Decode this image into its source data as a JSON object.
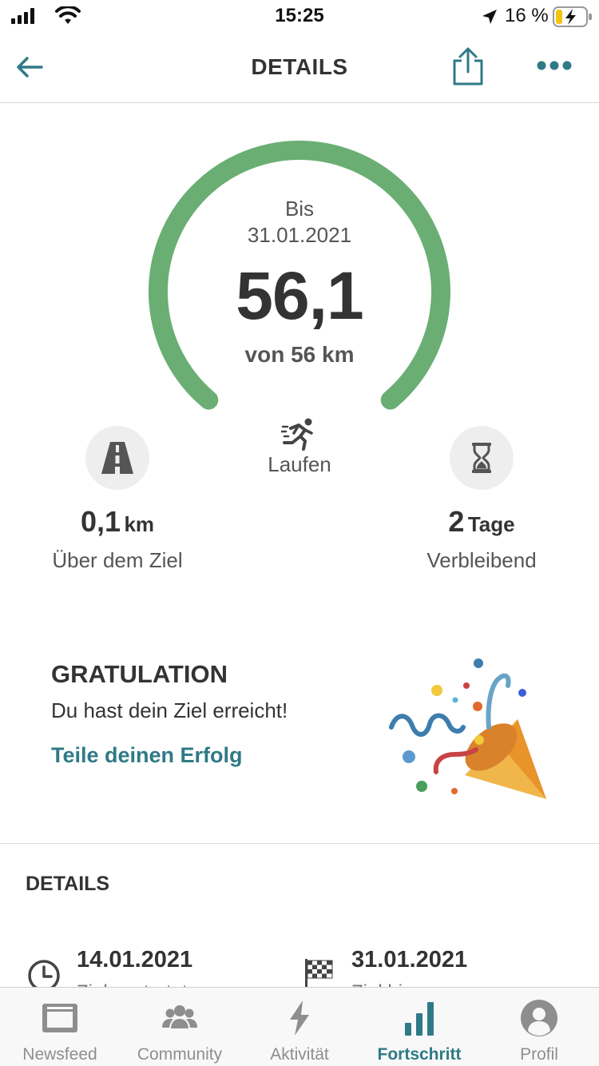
{
  "status_bar": {
    "time": "15:25",
    "battery_percent": "16 %"
  },
  "header": {
    "title": "DETAILS"
  },
  "goal": {
    "until_label": "Bis",
    "end_date": "31.01.2021",
    "value": "56,1",
    "target_text": "von 56 km",
    "progress_fraction": 1.0,
    "activity": "Laufen",
    "ring_color": "#6aae73"
  },
  "stats": {
    "over_goal_value": "0,1",
    "over_goal_unit": "km",
    "over_goal_label": "Über dem Ziel",
    "remaining_value": "2",
    "remaining_unit": "Tage",
    "remaining_label": "Verbleibend"
  },
  "congrats": {
    "title": "GRATULATION",
    "text": "Du hast dein Ziel erreicht!",
    "share_link": "Teile deinen Erfolg"
  },
  "details": {
    "title": "DETAILS",
    "start_date": "14.01.2021",
    "start_label": "Ziel gestartet",
    "end_date": "31.01.2021",
    "end_label": "Ziel bis"
  },
  "tabs": [
    {
      "label": "Newsfeed",
      "icon": "newsfeed-icon"
    },
    {
      "label": "Community",
      "icon": "community-icon"
    },
    {
      "label": "Aktivität",
      "icon": "activity-bolt-icon"
    },
    {
      "label": "Fortschritt",
      "icon": "progress-bars-icon",
      "active": true
    },
    {
      "label": "Profil",
      "icon": "profile-icon"
    }
  ],
  "colors": {
    "accent": "#2f7a86",
    "ring": "#6aae73"
  }
}
